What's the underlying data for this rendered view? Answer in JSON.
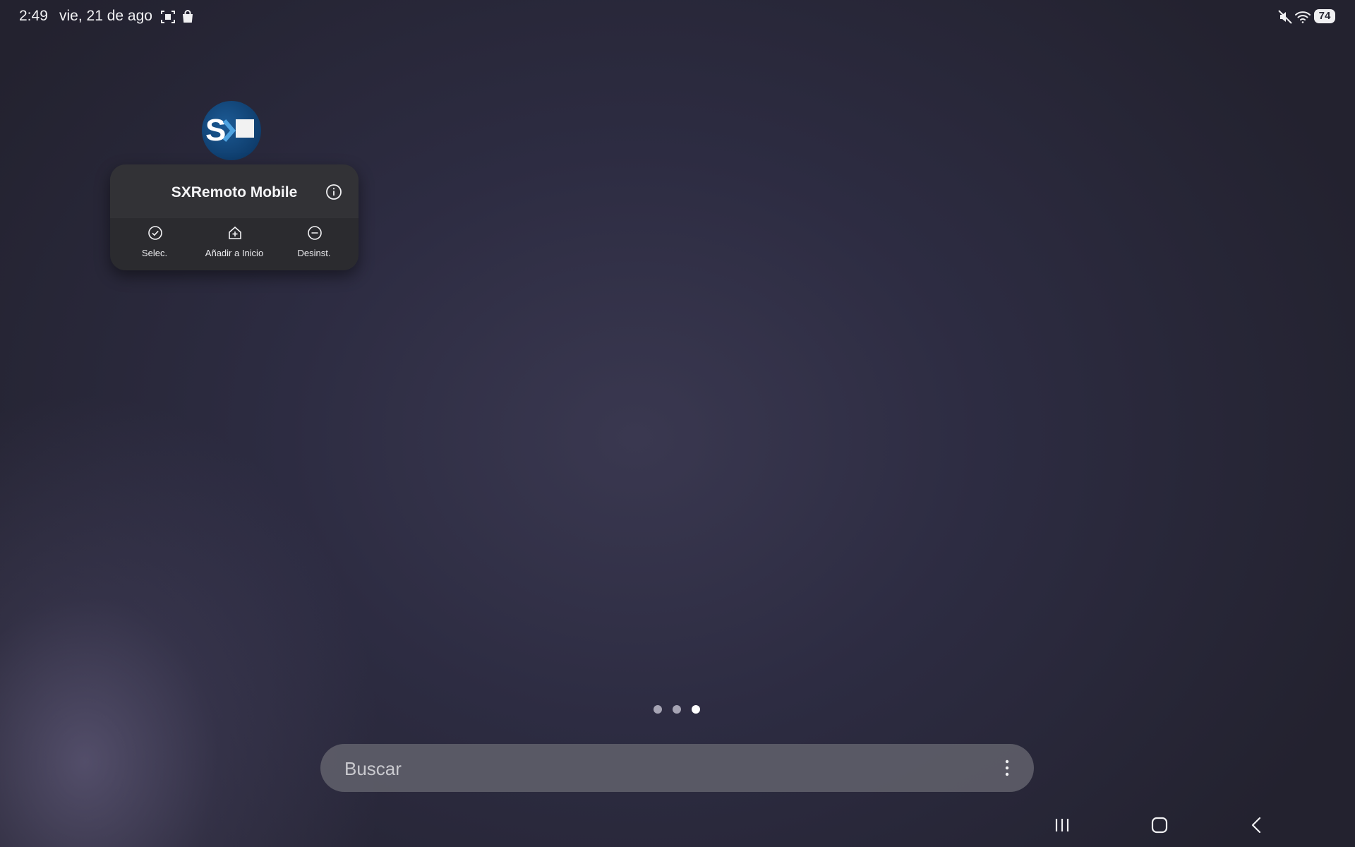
{
  "status_bar": {
    "time": "2:49",
    "date": "vie, 21 de ago",
    "battery": "74",
    "icons": [
      "screenshot-icon",
      "shopping-bag-icon",
      "mute-icon",
      "wifi-icon",
      "battery-icon"
    ]
  },
  "app_popup": {
    "app_name": "SXRemoto Mobile",
    "icon": "sxremoto-app-icon",
    "info_icon": "info-icon",
    "actions": [
      {
        "label": "Selec.",
        "icon": "check-circle-icon"
      },
      {
        "label": "Añadir a Inicio",
        "icon": "add-to-home-icon"
      },
      {
        "label": "Desinst.",
        "icon": "minus-circle-icon"
      }
    ]
  },
  "pagination": {
    "total": 3,
    "current": 3
  },
  "search": {
    "placeholder": "Buscar",
    "menu_icon": "more-vertical-icon"
  },
  "navigation_bar": {
    "buttons": [
      "recents-icon",
      "home-icon",
      "back-icon"
    ]
  },
  "colors": {
    "background": "#2d2c42",
    "popup": "#2f2f33",
    "app_icon_blue": "#0f3e6e",
    "search_bar": "#62626c"
  }
}
